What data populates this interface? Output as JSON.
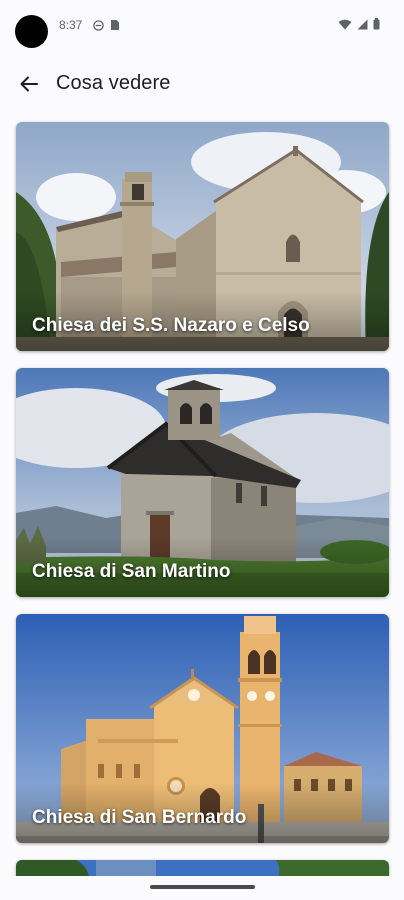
{
  "status_bar": {
    "time": "8:37"
  },
  "app_bar": {
    "title": "Cosa vedere",
    "back_icon": "arrow-back-icon"
  },
  "places": [
    {
      "name": "Chiesa dei S.S. Nazaro e Celso"
    },
    {
      "name": "Chiesa di San Martino"
    },
    {
      "name": "Chiesa di San Bernardo"
    }
  ],
  "colors": {
    "background": "#fbfbfd",
    "title_text": "#1f1f1f",
    "card_label": "#ffffff"
  }
}
